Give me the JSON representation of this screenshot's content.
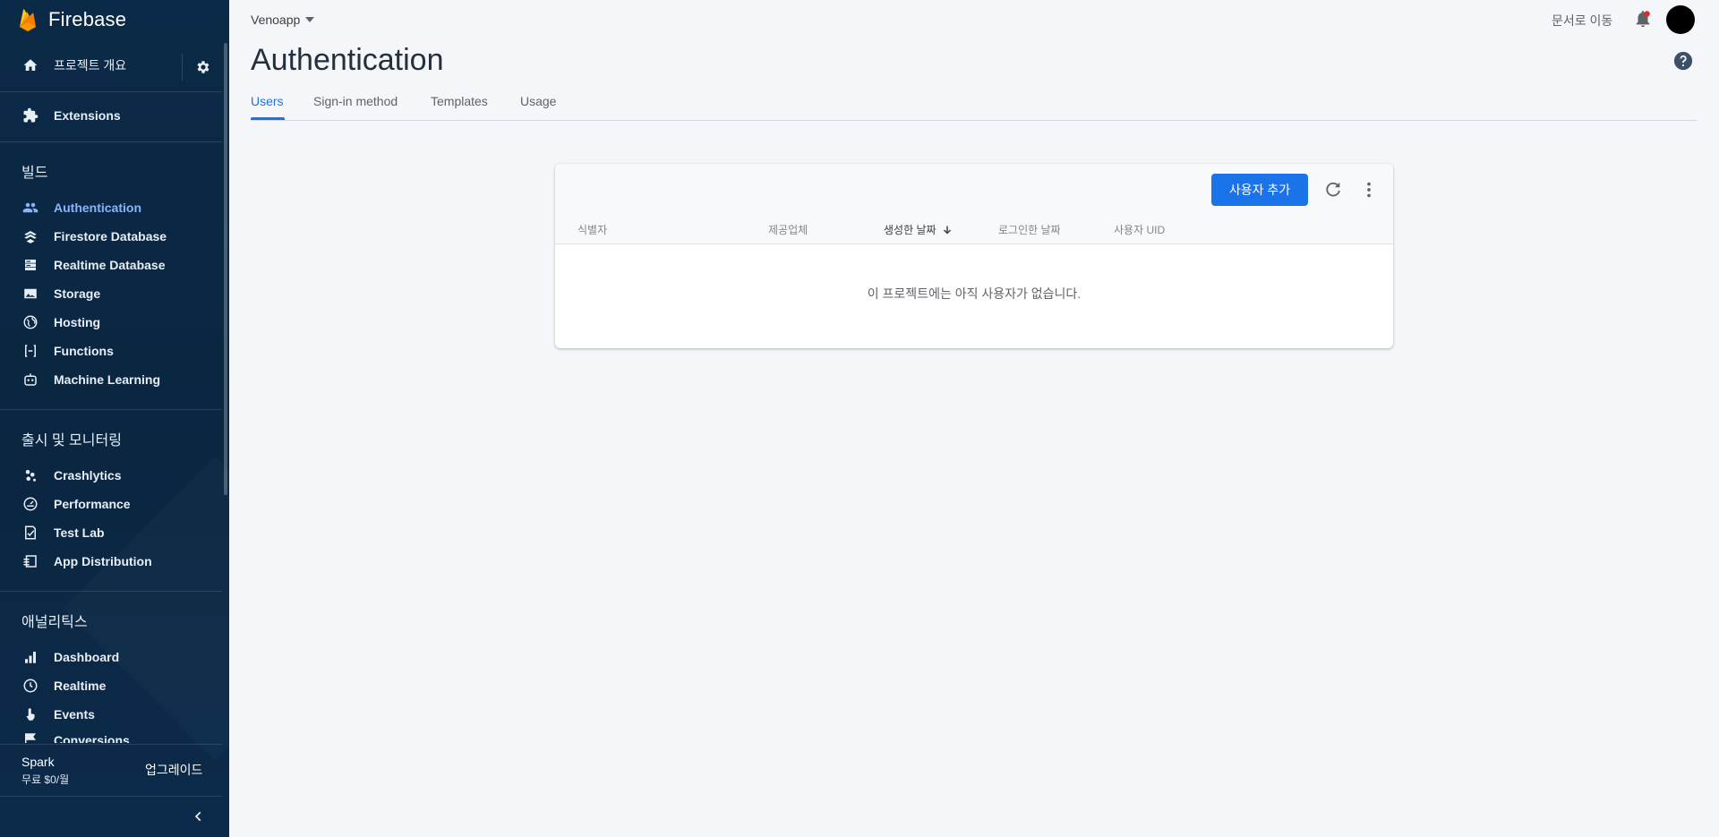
{
  "sidebar": {
    "brand": "Firebase",
    "home_label": "프로젝트 개요",
    "extensions_label": "Extensions",
    "build": {
      "title": "빌드",
      "items": [
        {
          "label": "Authentication",
          "icon": "people-icon"
        },
        {
          "label": "Firestore Database",
          "icon": "firestore-icon"
        },
        {
          "label": "Realtime Database",
          "icon": "database-icon"
        },
        {
          "label": "Storage",
          "icon": "image-icon"
        },
        {
          "label": "Hosting",
          "icon": "globe-icon"
        },
        {
          "label": "Functions",
          "icon": "functions-icon"
        },
        {
          "label": "Machine Learning",
          "icon": "robot-icon"
        }
      ]
    },
    "release": {
      "title": "출시 및 모니터링",
      "items": [
        {
          "label": "Crashlytics",
          "icon": "crashlytics-icon"
        },
        {
          "label": "Performance",
          "icon": "speedometer-icon"
        },
        {
          "label": "Test Lab",
          "icon": "checklist-icon"
        },
        {
          "label": "App Distribution",
          "icon": "distribution-icon"
        }
      ]
    },
    "analytics": {
      "title": "애널리틱스",
      "items": [
        {
          "label": "Dashboard",
          "icon": "bar-chart-icon"
        },
        {
          "label": "Realtime",
          "icon": "clock-icon"
        },
        {
          "label": "Events",
          "icon": "touch-icon"
        },
        {
          "label": "Conversions",
          "icon": "flag-icon"
        }
      ]
    },
    "plan": {
      "name": "Spark",
      "price": "무료 $0/월",
      "upgrade_label": "업그레이드"
    }
  },
  "header": {
    "project_name": "Venoapp",
    "docs_link": "문서로 이동",
    "page_title": "Authentication"
  },
  "tabs": [
    "Users",
    "Sign-in method",
    "Templates",
    "Usage"
  ],
  "users_table": {
    "add_user_label": "사용자 추가",
    "columns": [
      "식별자",
      "제공업체",
      "생성한 날짜",
      "로그인한 날짜",
      "사용자 UID"
    ],
    "sorted_column": "생성한 날짜",
    "empty_message": "이 프로젝트에는 아직 사용자가 없습니다."
  },
  "colors": {
    "sidebar_bg": "#0b2a47",
    "accent": "#1a73e8",
    "active_nav": "#8ab4f8",
    "brand_flame": "#ffa000"
  }
}
